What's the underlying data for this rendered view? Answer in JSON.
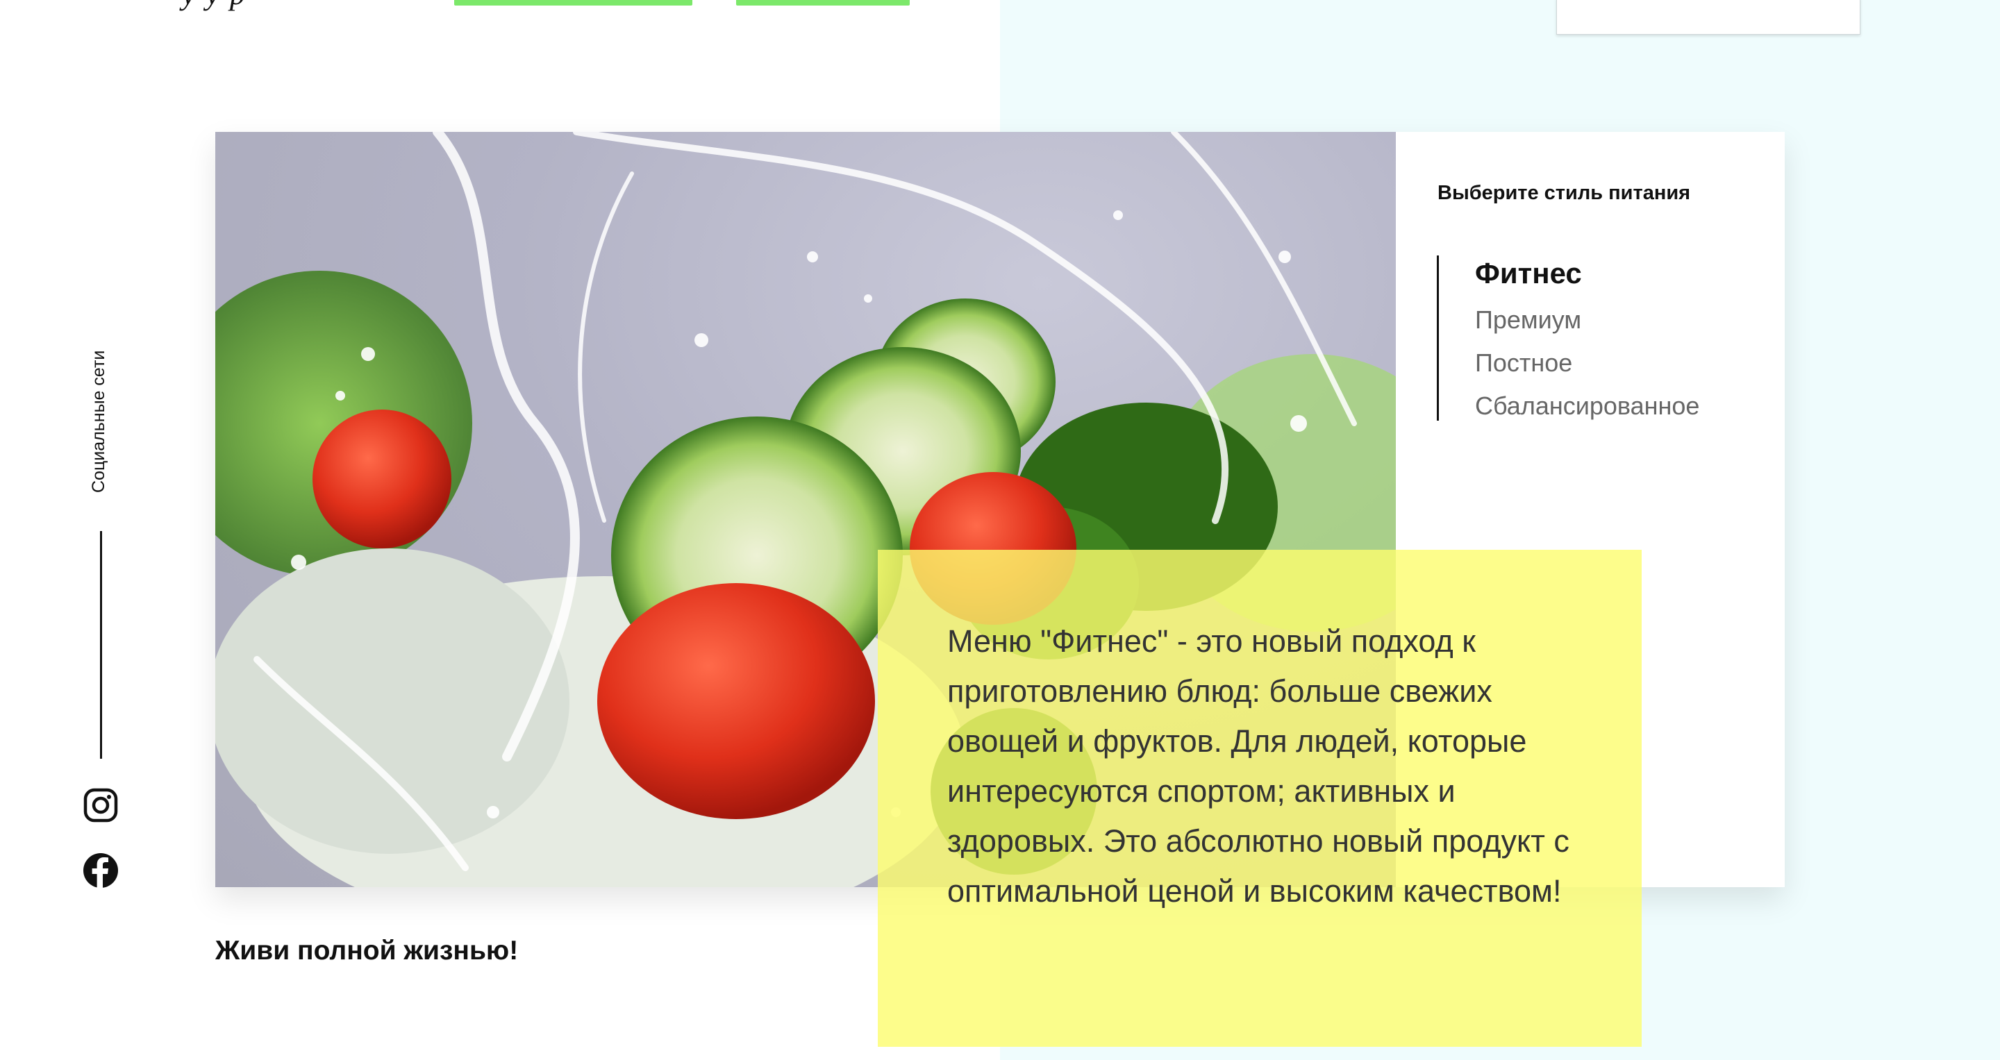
{
  "header": {
    "logo_fragment": "у у р",
    "nav_button_1": "",
    "nav_button_2": ""
  },
  "social": {
    "label": "Социальные сети",
    "icons": [
      "instagram-icon",
      "facebook-icon"
    ]
  },
  "diet_selector": {
    "title": "Выберите стиль питания",
    "items": [
      {
        "label": "Фитнес",
        "active": true
      },
      {
        "label": "Премиум",
        "active": false
      },
      {
        "label": "Постное",
        "active": false
      },
      {
        "label": "Сбалансированное",
        "active": false
      }
    ]
  },
  "description": "Меню \"Фитнес\" - это новый подход к приготовлению блюд: больше свежих овощей и фруктов. Для людей, которые интересуются спортом; активных и здоровых. Это абсолютно новый продукт с оптимальной ценой и высоким качеством!",
  "slogan": "Живи полной жизнью!",
  "colors": {
    "accent_green": "#7ce86a",
    "highlight_yellow": "#fcfc6e",
    "right_background": "#effcfd"
  }
}
